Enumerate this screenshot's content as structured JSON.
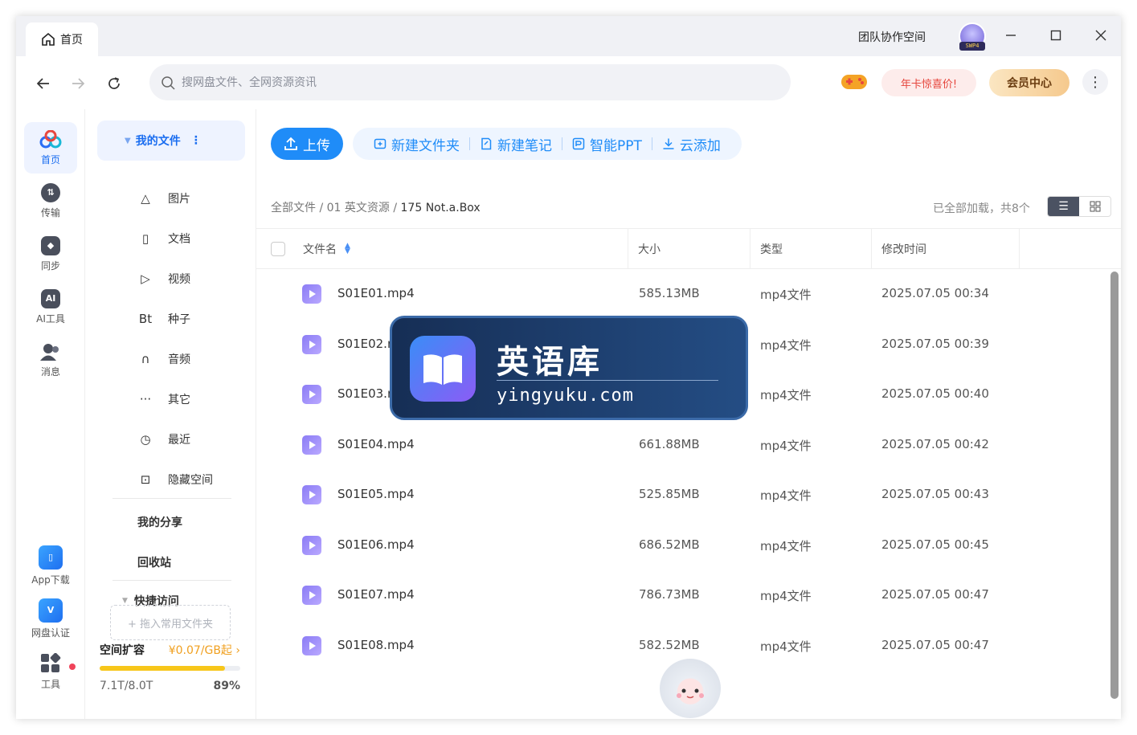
{
  "titlebar": {
    "tab_label": "首页",
    "team_space": "团队协作空间",
    "avatar_badge": "SWP4"
  },
  "navbar": {
    "search_placeholder": "搜网盘文件、全网资源资讯",
    "promo_label": "年卡惊喜价!",
    "vip_label": "会员中心"
  },
  "rail": {
    "items": [
      {
        "label": "首页",
        "icon": "cloud-logo-icon"
      },
      {
        "label": "传输",
        "icon": "transfer-icon"
      },
      {
        "label": "同步",
        "icon": "sync-icon"
      },
      {
        "label": "AI工具",
        "icon": "ai-icon"
      },
      {
        "label": "消息",
        "icon": "message-icon"
      }
    ],
    "bottom": [
      {
        "label": "App下载",
        "icon": "phone-icon"
      },
      {
        "label": "网盘认证",
        "icon": "verify-icon"
      },
      {
        "label": "工具",
        "icon": "grid-icon"
      }
    ]
  },
  "sidebar": {
    "my_files": "我的文件",
    "items": [
      {
        "label": "图片",
        "icon": "△"
      },
      {
        "label": "文档",
        "icon": "▯"
      },
      {
        "label": "视频",
        "icon": "▷"
      },
      {
        "label": "种子",
        "icon": "Bt"
      },
      {
        "label": "音频",
        "icon": "∩"
      },
      {
        "label": "其它",
        "icon": "···"
      },
      {
        "label": "最近",
        "icon": "◷"
      },
      {
        "label": "隐藏空间",
        "icon": "⊡"
      }
    ],
    "my_share": "我的分享",
    "recycle": "回收站",
    "quick_access": "快捷访问",
    "dropzone": "+ 拖入常用文件夹",
    "expand_label": "空间扩容",
    "expand_price": "¥0.07/GB起 ›",
    "usage_text": "7.1T/8.0T",
    "usage_percent": "89%",
    "usage_fraction": 0.89
  },
  "toolbar": {
    "upload": "上传",
    "new_folder": "新建文件夹",
    "new_note": "新建笔记",
    "smart_ppt": "智能PPT",
    "cloud_add": "云添加"
  },
  "breadcrumb": {
    "root": "全部文件",
    "sep1": " / ",
    "folder": "01 英文资源",
    "sep2": " / ",
    "current": "175 Not.a.Box"
  },
  "status": {
    "loaded": "已全部加载，共8个"
  },
  "table": {
    "headers": {
      "name": "文件名",
      "size": "大小",
      "type": "类型",
      "modified": "修改时间"
    },
    "rows": [
      {
        "name": "S01E01.mp4",
        "size": "585.13MB",
        "type": "mp4文件",
        "modified": "2025.07.05 00:34"
      },
      {
        "name": "S01E02.r",
        "size": "",
        "type": "mp4文件",
        "modified": "2025.07.05 00:39"
      },
      {
        "name": "S01E03.r",
        "size": "",
        "type": "mp4文件",
        "modified": "2025.07.05 00:40"
      },
      {
        "name": "S01E04.mp4",
        "size": "661.88MB",
        "type": "mp4文件",
        "modified": "2025.07.05 00:42"
      },
      {
        "name": "S01E05.mp4",
        "size": "525.85MB",
        "type": "mp4文件",
        "modified": "2025.07.05 00:43"
      },
      {
        "name": "S01E06.mp4",
        "size": "686.52MB",
        "type": "mp4文件",
        "modified": "2025.07.05 00:45"
      },
      {
        "name": "S01E07.mp4",
        "size": "786.73MB",
        "type": "mp4文件",
        "modified": "2025.07.05 00:47"
      },
      {
        "name": "S01E08.mp4",
        "size": "582.52MB",
        "type": "mp4文件",
        "modified": "2025.07.05 00:47"
      }
    ]
  },
  "watermark": {
    "title": "英语库",
    "subtitle": "yingyuku.com"
  },
  "colors": {
    "accent": "#1f8cf8",
    "promo": "#e6453c",
    "storage_bar": "#f7c61a"
  }
}
